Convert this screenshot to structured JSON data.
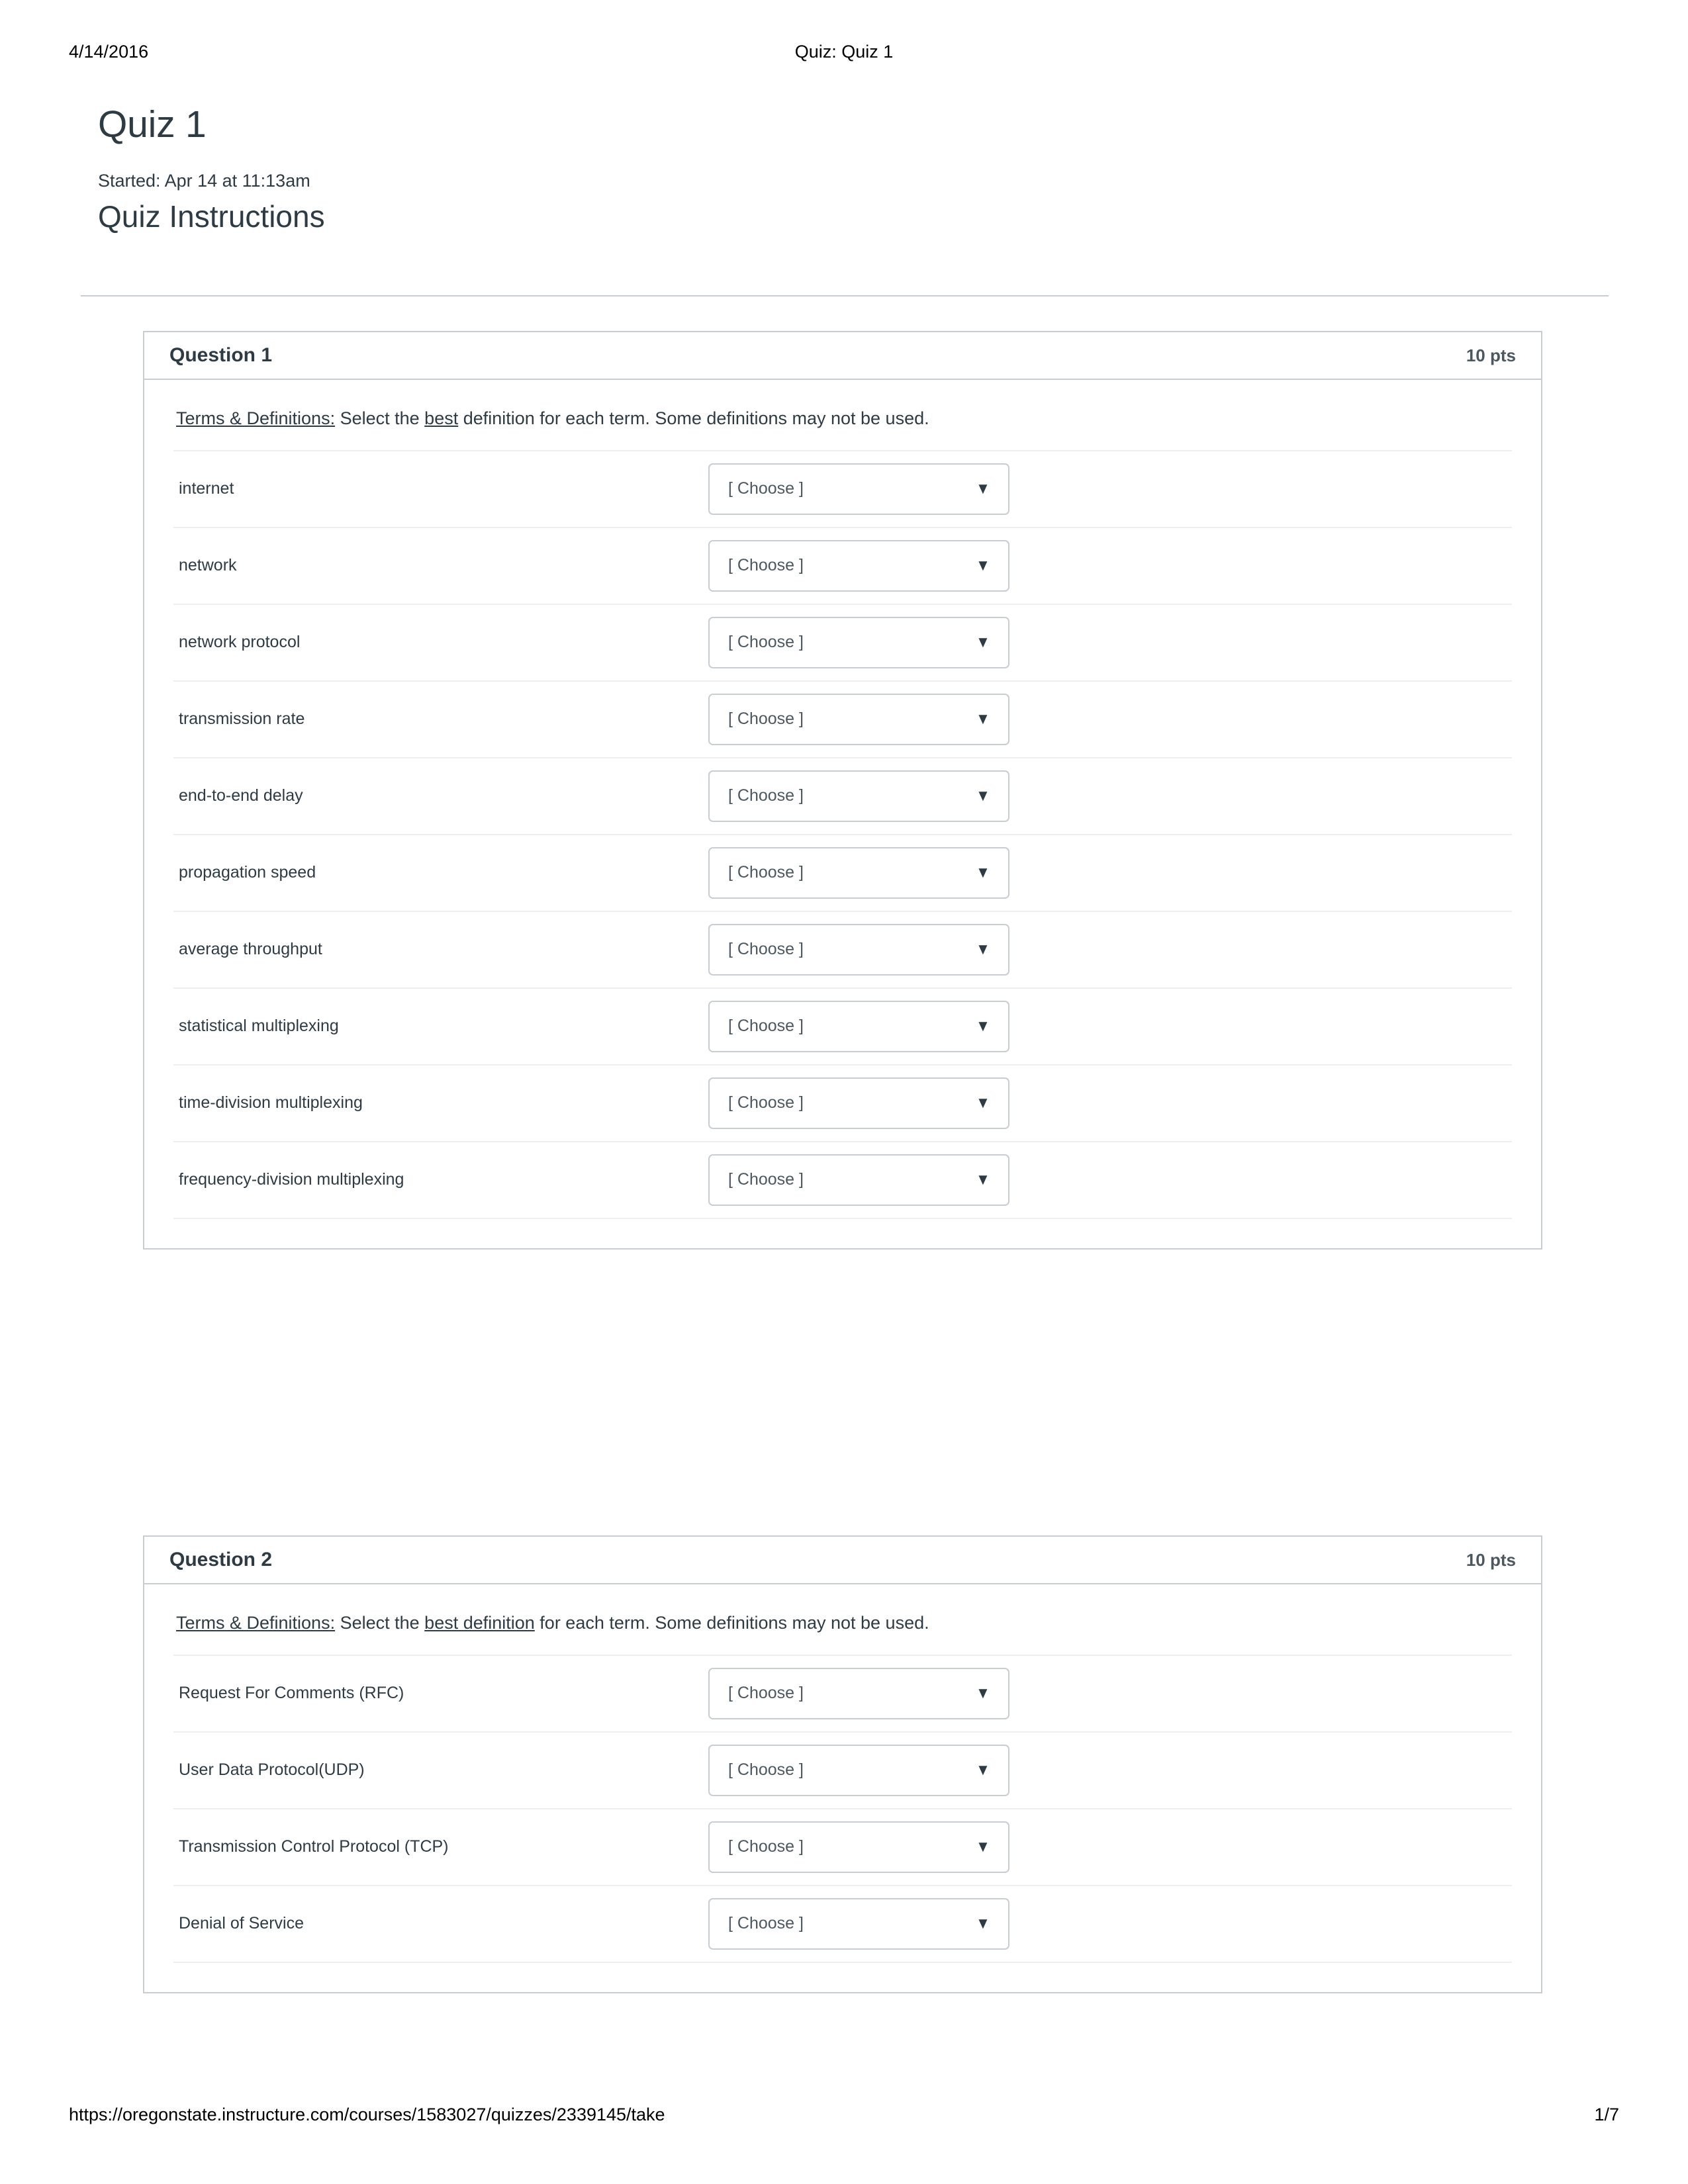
{
  "print_header": {
    "date": "4/14/2016",
    "title": "Quiz: Quiz 1"
  },
  "quiz": {
    "title": "Quiz 1",
    "started": "Started: Apr 14 at 11:13am",
    "instructions_heading": "Quiz Instructions"
  },
  "questions": [
    {
      "name": "Question 1",
      "points": "10 pts",
      "prompt": {
        "label": "Terms & Definitions:",
        "part1": " Select the ",
        "emphasis": "best",
        "part2": " definition for each term.  Some definitions may not be used."
      },
      "choose_label": "[ Choose ]",
      "caret": "▼",
      "rows": [
        {
          "term": "internet",
          "value": "[ Choose ]"
        },
        {
          "term": "network",
          "value": "[ Choose ]"
        },
        {
          "term": "network protocol",
          "value": "[ Choose ]"
        },
        {
          "term": "transmission rate",
          "value": "[ Choose ]"
        },
        {
          "term": "end-to-end delay",
          "value": "[ Choose ]"
        },
        {
          "term": "propagation speed",
          "value": "[ Choose ]"
        },
        {
          "term": "average throughput",
          "value": "[ Choose ]"
        },
        {
          "term": "statistical multiplexing",
          "value": "[ Choose ]"
        },
        {
          "term": "time-division multiplexing",
          "value": "[ Choose ]"
        },
        {
          "term": "frequency-division multiplexing",
          "value": "[ Choose ]"
        }
      ]
    },
    {
      "name": "Question 2",
      "points": "10 pts",
      "prompt": {
        "label": "Terms & Definitions:",
        "part1": " Select the ",
        "emphasis": "best definition",
        "part2": " for each term. Some definitions may not be used."
      },
      "choose_label": "[ Choose ]",
      "caret": "▼",
      "rows": [
        {
          "term": "Request For Comments (RFC)",
          "value": "[ Choose ]"
        },
        {
          "term": "User Data Protocol(UDP)",
          "value": "[ Choose ]"
        },
        {
          "term": "Transmission Control Protocol (TCP)",
          "value": "[ Choose ]"
        },
        {
          "term": "Denial of Service",
          "value": "[ Choose ]"
        }
      ]
    }
  ],
  "print_footer": {
    "url": "https://oregonstate.instructure.com/courses/1583027/quizzes/2339145/take",
    "page": "1/7"
  },
  "colors": {
    "border": "#c7cdd1",
    "row_rule": "#eceff1",
    "text": "#2d3b45",
    "muted": "#4c5860"
  }
}
